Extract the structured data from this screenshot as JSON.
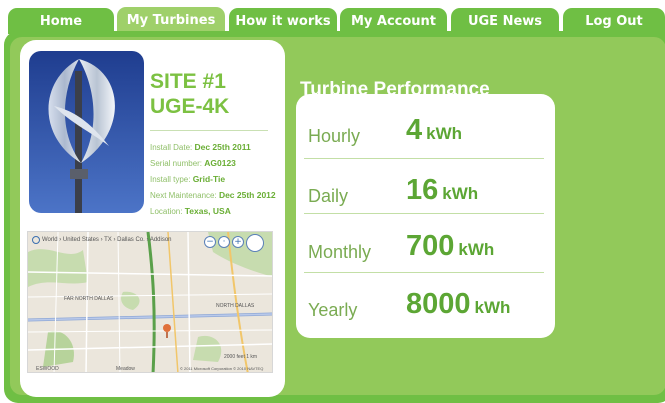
{
  "nav": {
    "tabs": [
      {
        "label": "Home"
      },
      {
        "label": "My Turbines"
      },
      {
        "label": "How it works"
      },
      {
        "label": "My Account"
      },
      {
        "label": "UGE News"
      },
      {
        "label": "Log Out"
      }
    ],
    "active_index": 1
  },
  "site": {
    "title_line1": "SITE #1",
    "title_line2": "UGE-4K",
    "details": [
      {
        "label": "Install Date: ",
        "value": "Dec 25th 2011"
      },
      {
        "label": "Serial number: ",
        "value": "AG0123"
      },
      {
        "label": "Install type: ",
        "value": "Grid-Tie"
      },
      {
        "label": "Next Maintenance: ",
        "value": "Dec 25th 2012"
      },
      {
        "label": "Location: ",
        "value": "Texas, USA"
      }
    ]
  },
  "map": {
    "breadcrumb": "World › United States › TX › Dallas Co. › Addison",
    "labels": {
      "north_dallas_left": "FAR NORTH DALLAS",
      "north_dallas_right": "NORTH DALLAS",
      "scale": "2000 feet      1 km",
      "attribution": "© 2011 Microsoft Corporation  © 2010 NAVTEQ",
      "bottom_left": "ESWOOD",
      "bottom_mid": "Meadow"
    }
  },
  "performance": {
    "title": "Turbine Performance",
    "rows": [
      {
        "label": "Hourly",
        "value": "4",
        "unit": "kWh"
      },
      {
        "label": "Daily",
        "value": "16",
        "unit": "kWh"
      },
      {
        "label": "Monthly",
        "value": "700",
        "unit": "kWh"
      },
      {
        "label": "Yearly",
        "value": "8000",
        "unit": "kWh"
      }
    ]
  },
  "colors": {
    "brand_green": "#6fbf44",
    "light_green": "#92c95a",
    "text_green": "#5ca634"
  }
}
